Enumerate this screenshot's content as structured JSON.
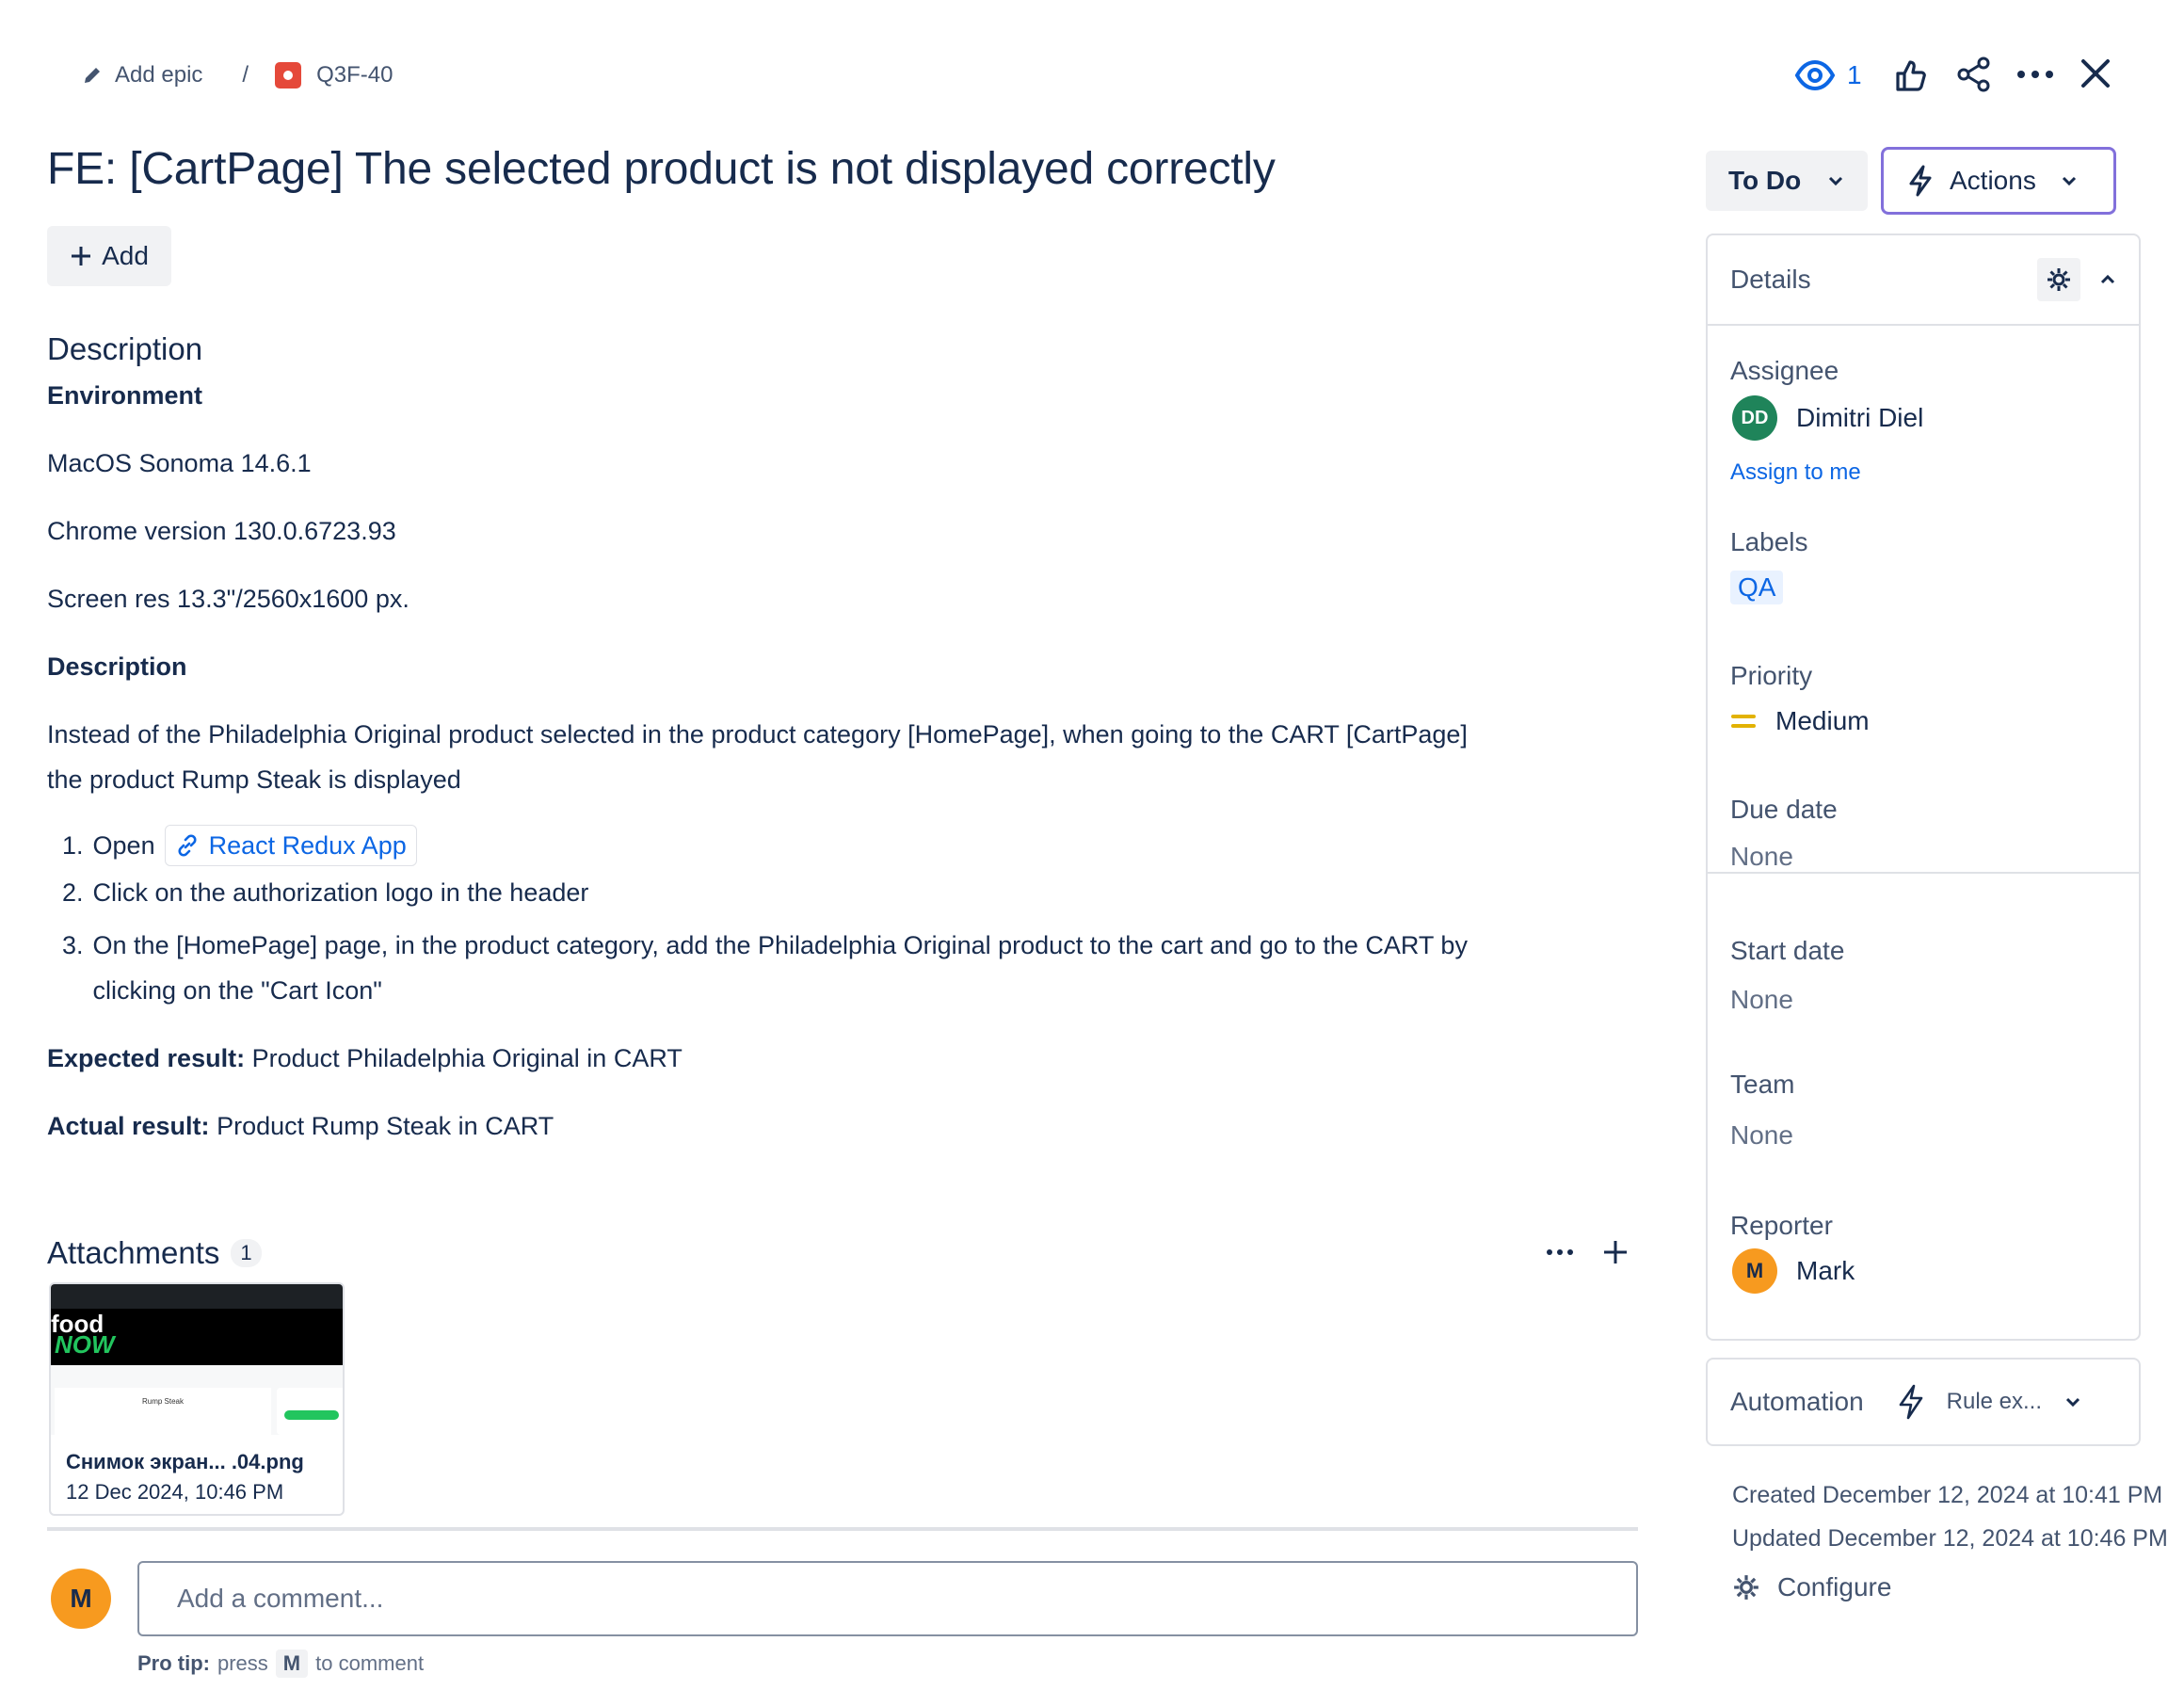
{
  "breadcrumb": {
    "add_epic": "Add epic",
    "separator": "/",
    "issue_key": "Q3F-40"
  },
  "header": {
    "watch_count": "1"
  },
  "issue": {
    "title": "FE: [CartPage] The selected product is not displayed correctly",
    "add_label": "Add"
  },
  "description": {
    "heading": "Description",
    "environment_heading": "Environment",
    "os": "MacOS Sonoma 14.6.1",
    "chrome": "Chrome version 130.0.6723.93",
    "screen": "Screen res 13.3\"/2560x1600 px.",
    "description_heading": "Description",
    "body_line1": "Instead of the Philadelphia Original product selected in the product category [HomePage], when going to the CART [CartPage]",
    "body_line2": "the product Rump Steak is displayed",
    "steps": {
      "n1": "1.",
      "s1_text": "Open",
      "s1_link": "React Redux App",
      "n2": "2.",
      "s2": "Click on the authorization logo in the header",
      "n3": "3.",
      "s3_line1": "On the [HomePage] page, in the product category, add the Philadelphia Original product to the cart and go to the CART by",
      "s3_line2": "clicking on the \"Cart Icon\""
    },
    "expected_label": "Expected result:",
    "expected_value": "Product Philadelphia Original in CART",
    "actual_label": "Actual result:",
    "actual_value": "Product Rump Steak in CART"
  },
  "attachments": {
    "heading": "Attachments",
    "count": "1",
    "file_name": "Снимок экран... .04.png",
    "file_date": "12 Dec 2024, 10:46 PM",
    "thumb_logo_top": "food",
    "thumb_logo_bottom": "NOW",
    "thumb_product": "Rump Steak"
  },
  "comment": {
    "avatar_initial": "M",
    "placeholder": "Add a comment...",
    "tip_bold": "Pro tip:",
    "tip_press": "press",
    "tip_key": "M",
    "tip_rest": "to comment"
  },
  "status": {
    "label": "To Do",
    "actions_label": "Actions"
  },
  "details": {
    "heading": "Details",
    "assignee_label": "Assignee",
    "assignee_initials": "DD",
    "assignee_name": "Dimitri Diel",
    "assign_to_me": "Assign to me",
    "labels_label": "Labels",
    "label_chip": "QA",
    "priority_label": "Priority",
    "priority_value": "Medium",
    "due_label": "Due date",
    "due_value": "None",
    "start_label": "Start date",
    "start_value": "None",
    "team_label": "Team",
    "team_value": "None",
    "reporter_label": "Reporter",
    "reporter_initial": "M",
    "reporter_name": "Mark"
  },
  "automation": {
    "heading": "Automation",
    "rule": "Rule ex..."
  },
  "meta": {
    "created": "Created December 12, 2024 at 10:41 PM",
    "updated": "Updated December 12, 2024 at 10:46 PM",
    "configure": "Configure"
  },
  "colors": {
    "accent": "#0c66e4",
    "assignee_avatar": "#1f845a",
    "reporter_avatar": "#f79a1f",
    "priority_medium": "#e2b203",
    "actions_border": "#8270db",
    "issue_type_bug": "#e5493a"
  }
}
